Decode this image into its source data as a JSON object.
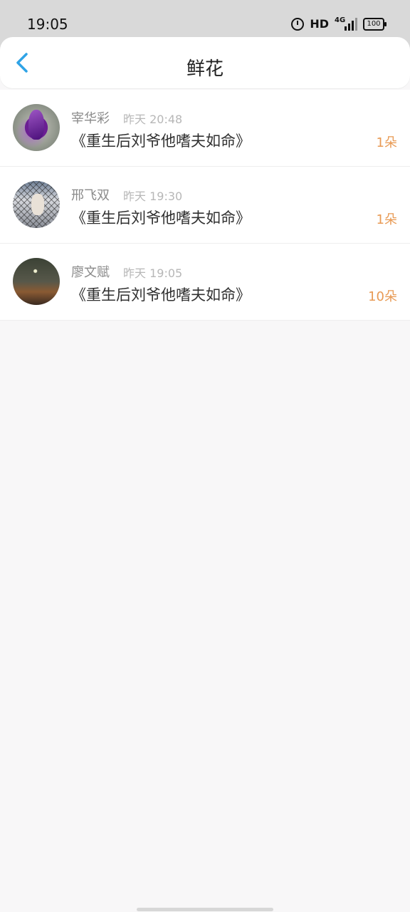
{
  "status_bar": {
    "time": "19:05",
    "hd": "HD",
    "network": "4G",
    "battery": "100"
  },
  "header": {
    "title": "鲜花"
  },
  "gifts": [
    {
      "name": "宰华彩",
      "time": "昨天 20:48",
      "book": "《重生后刘爷他嗜夫如命》",
      "count": "1朵"
    },
    {
      "name": "邢飞双",
      "time": "昨天 19:30",
      "book": "《重生后刘爷他嗜夫如命》",
      "count": "1朵"
    },
    {
      "name": "廖文赋",
      "time": "昨天 19:05",
      "book": "《重生后刘爷他嗜夫如命》",
      "count": "10朵"
    }
  ],
  "colors": {
    "accent_blue": "#2fa3e6",
    "count_orange": "#e89a54"
  }
}
